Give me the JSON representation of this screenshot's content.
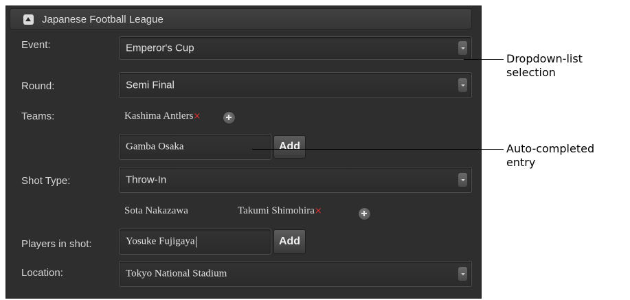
{
  "panel": {
    "header_title": "Japanese Football League",
    "collapse_icon": "chevron-up-icon"
  },
  "form": {
    "event": {
      "label": "Event:",
      "value": "Emperor's Cup"
    },
    "round": {
      "label": "Round:",
      "value": "Semi Final"
    },
    "teams": {
      "label": "Teams:",
      "tags": [
        "Kashima Antlers"
      ],
      "input_value": "Gamba Osaka",
      "add_label": "Add"
    },
    "shot_type": {
      "label": "Shot Type:",
      "value": "Throw-In",
      "tags": [
        "Sota Nakazawa",
        "Takumi Shimohira"
      ]
    },
    "players": {
      "label": "Players in shot:",
      "input_value": "Yosuke Fujigaya",
      "add_label": "Add"
    },
    "location": {
      "label": "Location:",
      "value": "Tokyo National Stadium"
    }
  },
  "callouts": {
    "dropdown": [
      "Dropdown-list",
      "selection"
    ],
    "autocomplete": [
      "Auto-completed",
      "entry"
    ]
  },
  "colors": {
    "panel_bg": "#2e2e2e",
    "remove_x": "#e03030"
  }
}
